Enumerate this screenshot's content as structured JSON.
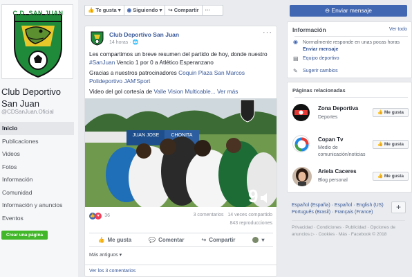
{
  "page": {
    "name": "Club Deportivo San Juan",
    "handle": "@CDSanJuan.Oficial",
    "crest_text": "C.D. SAN JUAN",
    "create_page_label": "Crear una página"
  },
  "left_nav": [
    "Inicio",
    "Publicaciones",
    "Videos",
    "Fotos",
    "Información",
    "Comunidad",
    "Información y anuncios",
    "Eventos"
  ],
  "action_bar": {
    "like": "Te gusta",
    "follow": "Siguiendo",
    "share": "Compartir",
    "more": "···"
  },
  "post": {
    "author": "Club Deportivo San Juan",
    "time": "14 horas",
    "line1": "Les compartimos un breve resumen del partido de hoy, donde nuestro",
    "hashtag": "#SanJuan",
    "line2": " Vencio 1 por 0 a Atlético Esperanzano",
    "sponsors_prefix": "Gracias a nuestros patrocinadores ",
    "sponsor1": "Coquin Plaza San Marcos",
    "sponsor2": "Polideportivo JAM'Sport",
    "video_prefix": "Video del gol cortesía de ",
    "video_link": "Valle Vision Multicable...",
    "see_more": "Ver más",
    "reactions_count": "36",
    "comments": "3 comentarios",
    "shares": "14 veces compartido",
    "views": "843 reproducciones",
    "like_label": "Me gusta",
    "comment_label": "Comentar",
    "share_label": "Compartir",
    "older_label": "Más antiguos",
    "view_comments": "Ver los 3 comentarios",
    "banner1": "JUAN JOSE",
    "banner2": "CHONITA"
  },
  "right": {
    "send_message": "Enviar mensaje",
    "info_title": "Información",
    "see_all": "Ver todo",
    "response_text": "Normalmente responde en unas pocas horas",
    "response_link": "Enviar mensaje",
    "category": "Equipo deportivo",
    "suggest": "Sugerir cambios",
    "related_title": "Páginas relacionadas",
    "related": [
      {
        "name": "Zona Deportiva",
        "sub": "Deportes",
        "btn": "Me gusta"
      },
      {
        "name": "Copan Tv",
        "sub": "Medio de comunicación/noticias",
        "btn": "Me gusta"
      },
      {
        "name": "Ariela Caceres",
        "sub": "Blog personal",
        "btn": "Me gusta"
      }
    ],
    "languages": "Español (España) · Español · English (US) Português (Brasil) · Français (France)",
    "plus": "+",
    "footer": "Privacidad · Condiciones · Publicidad · Opciones de anuncios ▷ · Cookies · Más · Facebook © 2018"
  },
  "colors": {
    "fb_blue": "#4267b2",
    "link": "#385898",
    "green": "#42b72a",
    "crest_green": "#1f8a3a"
  }
}
